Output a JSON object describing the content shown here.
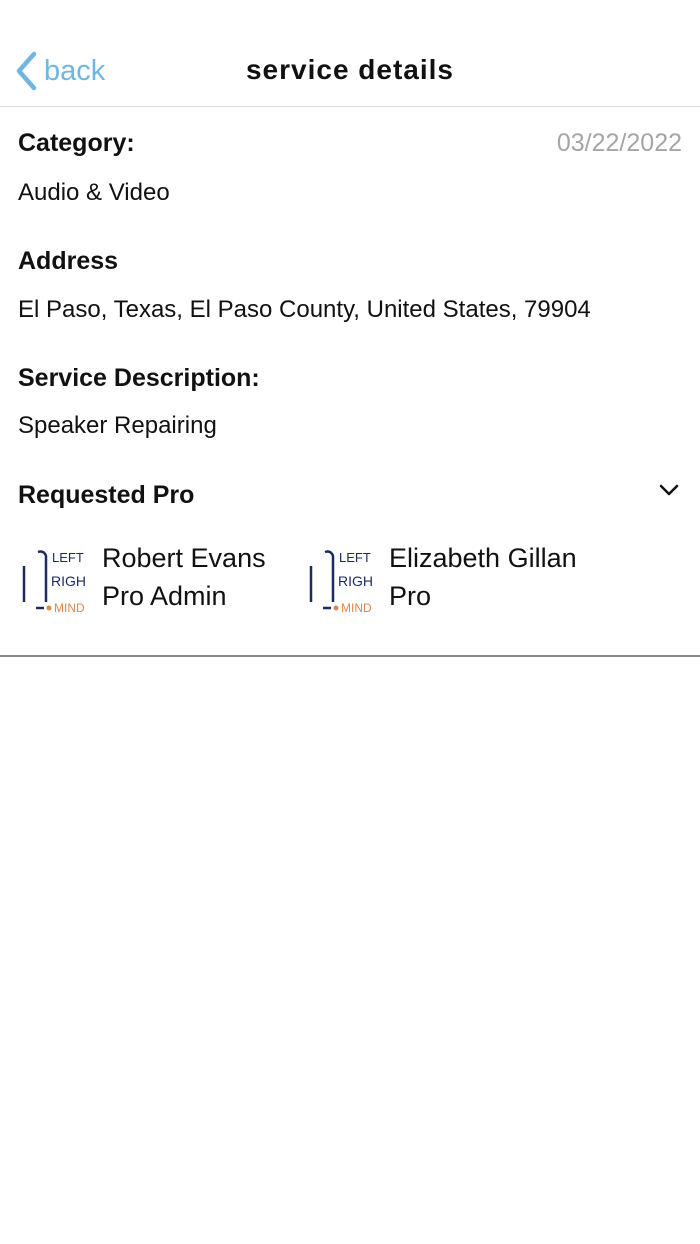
{
  "nav": {
    "back_label": "back",
    "title": "service details"
  },
  "details": {
    "category_label": "Category:",
    "category_value": "Audio & Video",
    "date": "03/22/2022",
    "address_label": "Address",
    "address_value": "El Paso, Texas, El Paso County, United States, 79904",
    "description_label": "Service Description:",
    "description_value": "Speaker Repairing",
    "requested_pro_label": "Requested Pro"
  },
  "pros": [
    {
      "name": "Robert Evans",
      "role": "Pro Admin",
      "avatar_logo": [
        "LEFT",
        "RIGHT",
        "MIND"
      ]
    },
    {
      "name": "Elizabeth Gillan",
      "role": "Pro",
      "avatar_logo": [
        "LEFT",
        "RIGHT",
        "MIND"
      ]
    }
  ],
  "colors": {
    "accent": "#6fb6e2",
    "date_gray": "#a5a5a5",
    "logo_navy": "#1c2a5e",
    "logo_orange": "#e0874a"
  },
  "icons": {
    "back": "chevron-left-icon",
    "expand": "chevron-down-icon"
  }
}
